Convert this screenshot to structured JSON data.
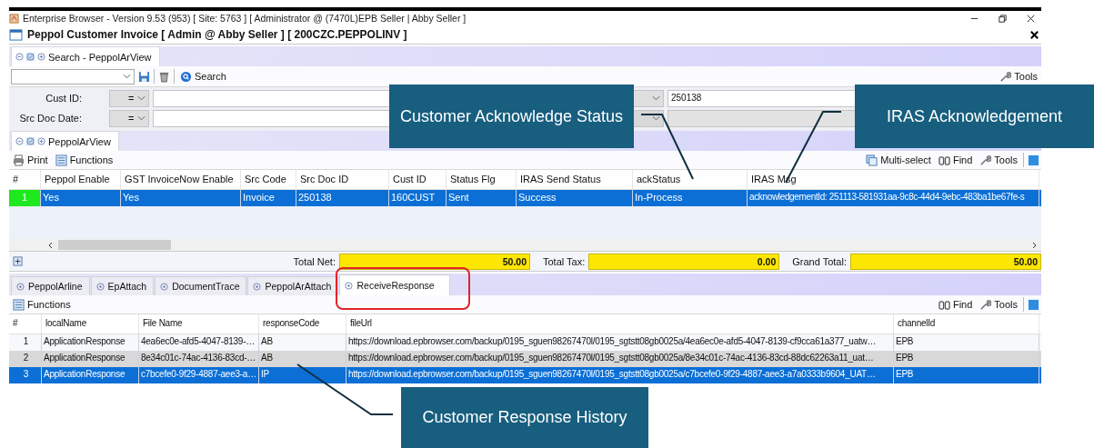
{
  "window": {
    "title": "Enterprise Browser - Version 9.53 (953) [ Site: 5763 ] [ Administrator @ (7470L)EPB Seller | Abby Seller ]"
  },
  "document": {
    "title": "Peppol Customer Invoice [ Admin @ Abby Seller ] [ 200CZC.PEPPOLINV ]"
  },
  "search_panel": {
    "tab": {
      "label": "Search - PeppolArView"
    },
    "toolbar": {
      "search": "Search",
      "tools": "Tools"
    },
    "filters": [
      {
        "label": "Cust ID:",
        "operator": "=",
        "right_value": "250138",
        "right_disabled": false
      },
      {
        "label": "Src Doc Date:",
        "operator": "=",
        "right_disabled": true
      }
    ]
  },
  "view_panel": {
    "tab": {
      "label": "PeppolArView"
    },
    "toolbar_left": [
      "Print",
      "Functions"
    ],
    "toolbar_right": [
      "Multi-select",
      "Find",
      "Tools"
    ],
    "table": {
      "columns": [
        "#",
        "Peppol Enable",
        "GST InvoiceNow Enable",
        "Src Code",
        "Src Doc ID",
        "Cust ID",
        "Status Flg",
        "IRAS Send Status",
        "ackStatus",
        "IRAS Msg"
      ],
      "rows": [
        {
          "selected": true,
          "cells": [
            "1",
            "Yes",
            "Yes",
            "Invoice",
            "250138",
            "160CUST",
            "Sent",
            "Success",
            "In-Process",
            "acknowledgementId: 251113-581931aa-9c8c-44d4-9ebc-483ba1be67fe-s"
          ]
        }
      ]
    },
    "totals": [
      {
        "label": "Total Net:",
        "value": "50.00"
      },
      {
        "label": "Total Tax:",
        "value": "0.00"
      },
      {
        "label": "Grand Total:",
        "value": "50.00"
      }
    ]
  },
  "detail_tabs": [
    {
      "label": "PeppolArline",
      "selected": false,
      "highlighted": false
    },
    {
      "label": "EpAttach",
      "selected": false,
      "highlighted": false
    },
    {
      "label": "DocumentTrace",
      "selected": false,
      "highlighted": false
    },
    {
      "label": "PeppolArAttach",
      "selected": false,
      "highlighted": false
    },
    {
      "label": "ReceiveResponse",
      "selected": true,
      "highlighted": true
    }
  ],
  "detail_panel": {
    "toolbar_left": [
      "Functions"
    ],
    "toolbar_right": [
      "Find",
      "Tools"
    ],
    "table": {
      "columns": [
        "#",
        "localName",
        "File Name",
        "responseCode",
        "fileUrl",
        "channelId"
      ],
      "rows": [
        {
          "selected": false,
          "cells": [
            "1",
            "ApplicationResponse",
            "4ea6ec0e-afd5-4047-8139-…",
            "AB",
            "https://download.epbrowser.com/backup/0195_sguen98267470l/0195_sgtstt08gb0025a/4ea6ec0e-afd5-4047-8139-cf9cca61a377_uatw…",
            "EPB"
          ]
        },
        {
          "selected": false,
          "cells": [
            "2",
            "ApplicationResponse",
            "8e34c01c-74ac-4136-83cd-…",
            "AB",
            "https://download.epbrowser.com/backup/0195_sguen98267470l/0195_sgtstt08gb0025a/8e34c01c-74ac-4136-83cd-88dc62263a11_uat…",
            "EPB"
          ]
        },
        {
          "selected": true,
          "cells": [
            "3",
            "ApplicationResponse",
            "c7bcefe0-9f29-4887-aee3-a…",
            "IP",
            "https://download.epbrowser.com/backup/0195_sguen98267470l/0195_sgtstt08gb0025a/c7bcefe0-9f29-4887-aee3-a7a0333b9604_UAT…",
            "EPB"
          ]
        }
      ]
    }
  },
  "callouts": [
    {
      "text": "Customer Acknowledge Status"
    },
    {
      "text": "IRAS Acknowledgement"
    },
    {
      "text": "Customer Response History"
    }
  ]
}
